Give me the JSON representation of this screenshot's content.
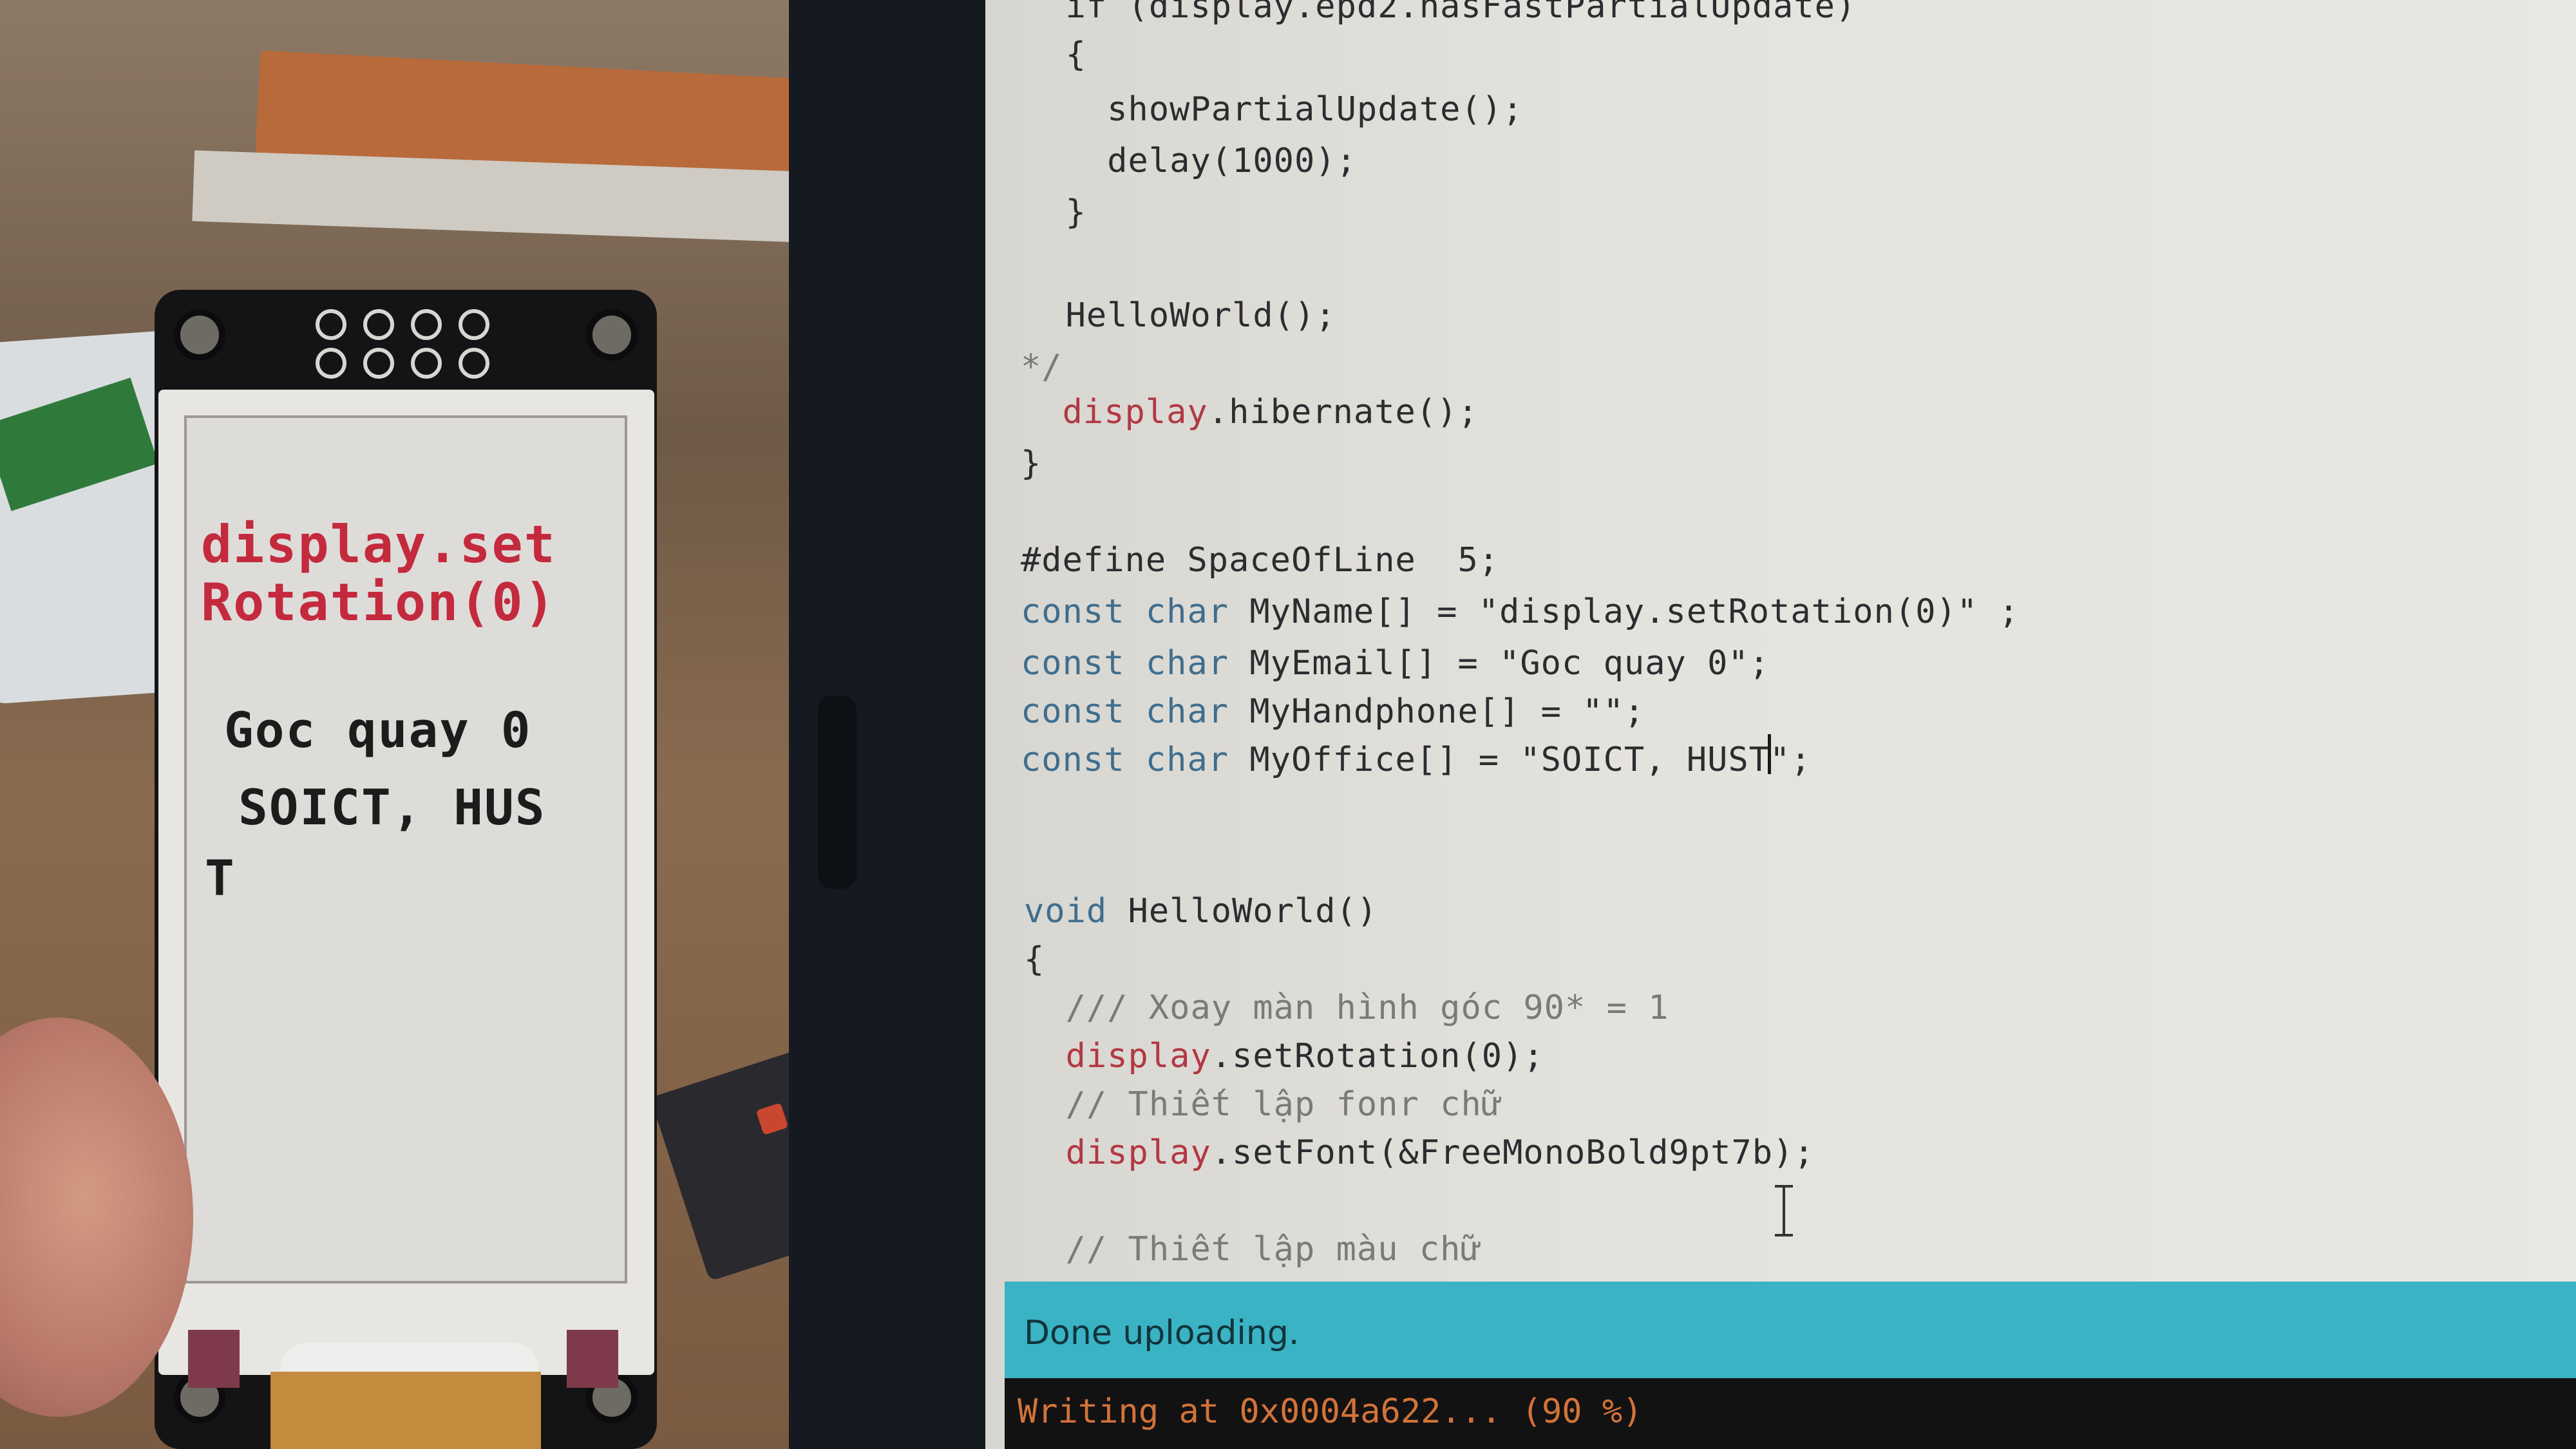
{
  "epaper": {
    "line1": "display.set",
    "line2": "Rotation(0)",
    "line3": "Goc quay 0",
    "line4": "SOICT, HUS",
    "line5": "T",
    "colors": {
      "red": "#c42a3e",
      "black": "#1c1c1c"
    }
  },
  "editor": {
    "lines": [
      {
        "parts": [
          {
            "t": "  if (display.epd2.hasFastPartialUpdate)",
            "c": ""
          }
        ]
      },
      {
        "parts": [
          {
            "t": "  {",
            "c": ""
          }
        ]
      },
      {
        "parts": [
          {
            "t": "    showPartialUpdate();",
            "c": ""
          }
        ]
      },
      {
        "parts": [
          {
            "t": "    delay(1000);",
            "c": ""
          }
        ]
      },
      {
        "parts": [
          {
            "t": "  }",
            "c": ""
          }
        ]
      },
      {
        "parts": [
          {
            "t": "  HelloWorld();",
            "c": ""
          }
        ]
      },
      {
        "parts": [
          {
            "t": "*/",
            "c": "cm"
          }
        ]
      },
      {
        "parts": [
          {
            "t": "  ",
            "c": ""
          },
          {
            "t": "display",
            "c": "fn"
          },
          {
            "t": ".hibernate();",
            "c": ""
          }
        ]
      },
      {
        "parts": [
          {
            "t": "}",
            "c": ""
          }
        ]
      },
      {
        "parts": [
          {
            "t": "#define SpaceOfLine  5;",
            "c": ""
          }
        ]
      },
      {
        "parts": [
          {
            "t": "const char",
            "c": "kw"
          },
          {
            "t": " MyName[] = \"display.setRotation(0)\" ;",
            "c": ""
          }
        ]
      },
      {
        "parts": [
          {
            "t": "const char",
            "c": "kw"
          },
          {
            "t": " MyEmail[] = \"Goc quay 0\";",
            "c": ""
          }
        ]
      },
      {
        "parts": [
          {
            "t": "const char",
            "c": "kw"
          },
          {
            "t": " MyHandphone[] = \"\";",
            "c": ""
          }
        ]
      },
      {
        "parts": [
          {
            "t": "const char",
            "c": "kw"
          },
          {
            "t": " MyOffice[] = \"SOICT, HUST\";",
            "c": ""
          }
        ]
      },
      {
        "parts": [
          {
            "t": "void",
            "c": "kw"
          },
          {
            "t": " HelloWorld()",
            "c": ""
          }
        ]
      },
      {
        "parts": [
          {
            "t": "{",
            "c": ""
          }
        ]
      },
      {
        "parts": [
          {
            "t": "  /// Xoay màn hình góc 90* = 1",
            "c": "cm"
          }
        ]
      },
      {
        "parts": [
          {
            "t": "  ",
            "c": ""
          },
          {
            "t": "display",
            "c": "fn"
          },
          {
            "t": ".setRotation(0);",
            "c": ""
          }
        ]
      },
      {
        "parts": [
          {
            "t": "  // Thiết lập fonr chữ",
            "c": "cm"
          }
        ]
      },
      {
        "parts": [
          {
            "t": "  ",
            "c": ""
          },
          {
            "t": "display",
            "c": "fn"
          },
          {
            "t": ".setFont(&FreeMonoBold9pt7b);",
            "c": ""
          }
        ]
      },
      {
        "parts": [
          {
            "t": "  // Thiết lập màu chữ",
            "c": "cm"
          }
        ]
      }
    ]
  },
  "status": {
    "message": "Done uploading."
  },
  "console": {
    "output": "Writing at 0x0004a622... (90 %)"
  }
}
